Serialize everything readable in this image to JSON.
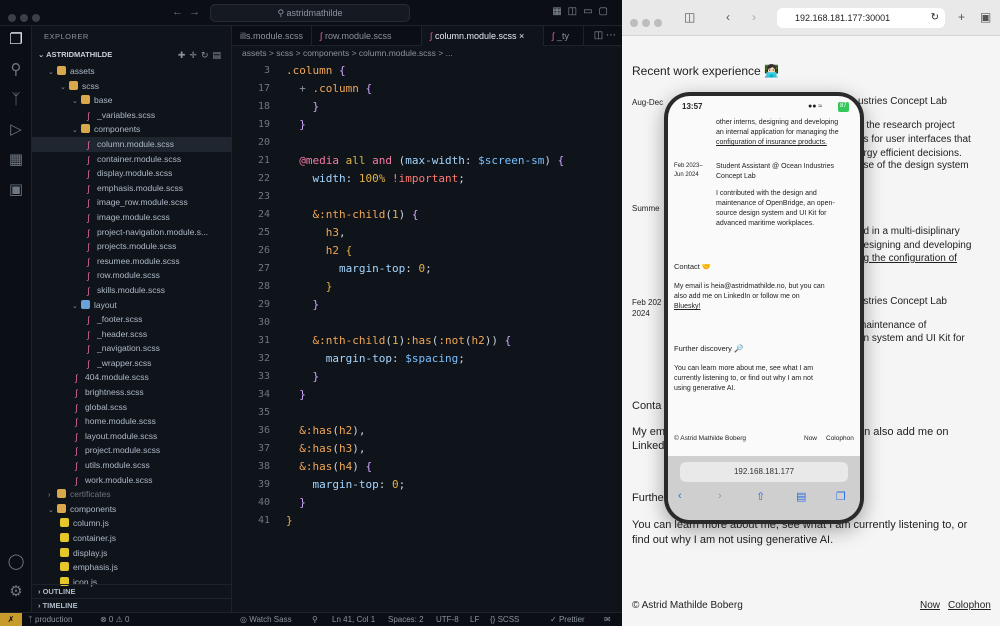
{
  "vscode": {
    "command_center": "astridmathilde",
    "explorer_title": "EXPLORER",
    "folder_name": "ASTRIDMATHILDE",
    "tree": [
      {
        "label": "assets",
        "type": "folder",
        "depth": 1,
        "open": true
      },
      {
        "label": "scss",
        "type": "folder",
        "depth": 2,
        "open": true
      },
      {
        "label": "base",
        "type": "folder",
        "depth": 3,
        "open": true
      },
      {
        "label": "_variables.scss",
        "type": "scss",
        "depth": 4
      },
      {
        "label": "components",
        "type": "folder",
        "depth": 3,
        "open": true
      },
      {
        "label": "column.module.scss",
        "type": "scss",
        "depth": 4,
        "selected": true
      },
      {
        "label": "container.module.scss",
        "type": "scss",
        "depth": 4
      },
      {
        "label": "display.module.scss",
        "type": "scss",
        "depth": 4
      },
      {
        "label": "emphasis.module.scss",
        "type": "scss",
        "depth": 4
      },
      {
        "label": "image_row.module.scss",
        "type": "scss",
        "depth": 4
      },
      {
        "label": "image.module.scss",
        "type": "scss",
        "depth": 4
      },
      {
        "label": "project-navigation.module.s...",
        "type": "scss",
        "depth": 4
      },
      {
        "label": "projects.module.scss",
        "type": "scss",
        "depth": 4
      },
      {
        "label": "resumee.module.scss",
        "type": "scss",
        "depth": 4
      },
      {
        "label": "row.module.scss",
        "type": "scss",
        "depth": 4
      },
      {
        "label": "skills.module.scss",
        "type": "scss",
        "depth": 4
      },
      {
        "label": "layout",
        "type": "folder2",
        "depth": 3,
        "open": true
      },
      {
        "label": "_footer.scss",
        "type": "scss",
        "depth": 4
      },
      {
        "label": "_header.scss",
        "type": "scss",
        "depth": 4
      },
      {
        "label": "_navigation.scss",
        "type": "scss",
        "depth": 4
      },
      {
        "label": "_wrapper.scss",
        "type": "scss",
        "depth": 4
      },
      {
        "label": "404.module.scss",
        "type": "scss",
        "depth": 3
      },
      {
        "label": "brightness.scss",
        "type": "scss",
        "depth": 3
      },
      {
        "label": "global.scss",
        "type": "scss",
        "depth": 3
      },
      {
        "label": "home.module.scss",
        "type": "scss",
        "depth": 3
      },
      {
        "label": "layout.module.scss",
        "type": "scss",
        "depth": 3
      },
      {
        "label": "project.module.scss",
        "type": "scss",
        "depth": 3
      },
      {
        "label": "utils.module.scss",
        "type": "scss",
        "depth": 3
      },
      {
        "label": "work.module.scss",
        "type": "scss",
        "depth": 3
      },
      {
        "label": "certificates",
        "type": "folder",
        "depth": 1,
        "open": false,
        "dim": true
      },
      {
        "label": "components",
        "type": "folder",
        "depth": 1,
        "open": true
      },
      {
        "label": "column.js",
        "type": "js",
        "depth": 2
      },
      {
        "label": "container.js",
        "type": "js",
        "depth": 2
      },
      {
        "label": "display.js",
        "type": "js",
        "depth": 2
      },
      {
        "label": "emphasis.js",
        "type": "js",
        "depth": 2
      },
      {
        "label": "icon.js",
        "type": "js",
        "depth": 2
      }
    ],
    "outline_label": "OUTLINE",
    "timeline_label": "TIMELINE",
    "tabs": [
      "ills.module.scss",
      "row.module.scss",
      "column.module.scss",
      "_ty"
    ],
    "active_tab": 2,
    "breadcrumb": "assets > scss > components > column.module.scss > ...",
    "line_numbers": [
      "3",
      "17",
      "18",
      "19",
      "20",
      "21",
      "22",
      "23",
      "24",
      "25",
      "26",
      "27",
      "28",
      "29",
      "30",
      "31",
      "32",
      "33",
      "34",
      "35",
      "36",
      "37",
      "38",
      "39",
      "40",
      "41"
    ],
    "status": {
      "branch": "production",
      "problems": "⊗ 0 ⚠ 0",
      "watch": "Watch Sass",
      "position": "Ln 41, Col 1",
      "spaces": "Spaces: 2",
      "encoding": "UTF-8",
      "eol": "LF",
      "language": "SCSS",
      "formatter": "Prettier"
    }
  },
  "browser": {
    "url": "192.168.181.177:30001",
    "recent_heading": "Recent work experience 👩🏻‍💻",
    "bg_text": [
      "Aug-Dec",
      "ustries Concept Lab",
      "n the research project",
      "ds for user interfaces that",
      "ergy efficient decisions.",
      "ase of the design system",
      "Summe",
      "g",
      "ed in a multi-disiplinary",
      "designing and developing",
      "ng the configuration of",
      "Feb 202",
      "ustries Concept Lab",
      "2024",
      "maintenance of",
      "gn system and UI Kit for",
      "Conta",
      "My em",
      "an also add me on",
      "Linked",
      "Furthe",
      "You can learn more about me, see what I am currently listening to, or",
      "find out why I am not using generative AI."
    ],
    "footer_name": "© Astrid Mathilde Boberg",
    "footer_now": "Now",
    "footer_colophon": "Colophon"
  },
  "phone": {
    "time": "13:57",
    "battery": "87",
    "intro_lines": [
      "other interns, designing and developing",
      "an internal application for managing the",
      "configuration of insurance products."
    ],
    "job_date": [
      "Feb 2023–",
      "Jun 2024"
    ],
    "job_title": [
      "Student Assistant @ Ocean Industries",
      "Concept Lab"
    ],
    "job_desc": [
      "I contributed with the design and",
      "maintenance of OpenBridge, an open-",
      "source design system and UI Kit for",
      "advanced maritime workplaces."
    ],
    "contact_heading": "Contact 🤝",
    "contact_lines": [
      "My email is heia@astridmathilde.no, but you can",
      "also add me on LinkedIn or follow me on",
      "Bluesky!"
    ],
    "further_heading": "Further discovery 🔎",
    "further_lines": [
      "You can learn more about me, see what I am",
      "currently listening to, or find out why I am not",
      "using generative AI."
    ],
    "footer_name": "© Astrid Mathilde Boberg",
    "footer_now": "Now",
    "footer_colophon": "Colophon",
    "url": "192.168.181.177"
  }
}
